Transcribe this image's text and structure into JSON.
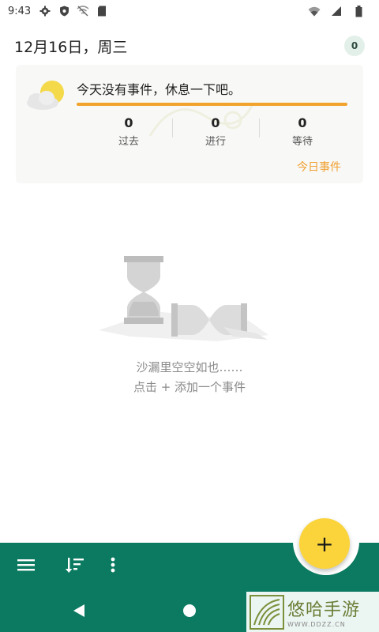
{
  "status_bar": {
    "time": "9:43",
    "icons_left": [
      "gear-icon",
      "shield-icon",
      "wifi-off-icon",
      "sd-card-icon"
    ],
    "icons_right": [
      "wifi-icon",
      "signal-icon",
      "battery-icon"
    ]
  },
  "header": {
    "date": "12月16日，周三",
    "count_badge": "0"
  },
  "summary_card": {
    "title": "今天没有事件，休息一下吧。",
    "progress_color": "#f1a32b",
    "stats": [
      {
        "value": "0",
        "label": "过去"
      },
      {
        "value": "0",
        "label": "进行"
      },
      {
        "value": "0",
        "label": "等待"
      }
    ],
    "today_link": "今日事件",
    "weather_icon": "partly-cloudy-icon"
  },
  "empty_state": {
    "illustration": "hourglass-icon",
    "line1": "沙漏里空空如也……",
    "line2": "点击 + 添加一个事件"
  },
  "bottom_bar": {
    "color": "#0b7a61",
    "icons": [
      "menu-icon",
      "sort-icon",
      "more-vert-icon"
    ],
    "fab_label": "+",
    "fab_color": "#fbd43b"
  },
  "nav_bar": {
    "icons": [
      "back-icon",
      "home-icon"
    ]
  },
  "watermark": {
    "name": "悠哈手游",
    "url": "WWW.DDZZ.CN"
  }
}
